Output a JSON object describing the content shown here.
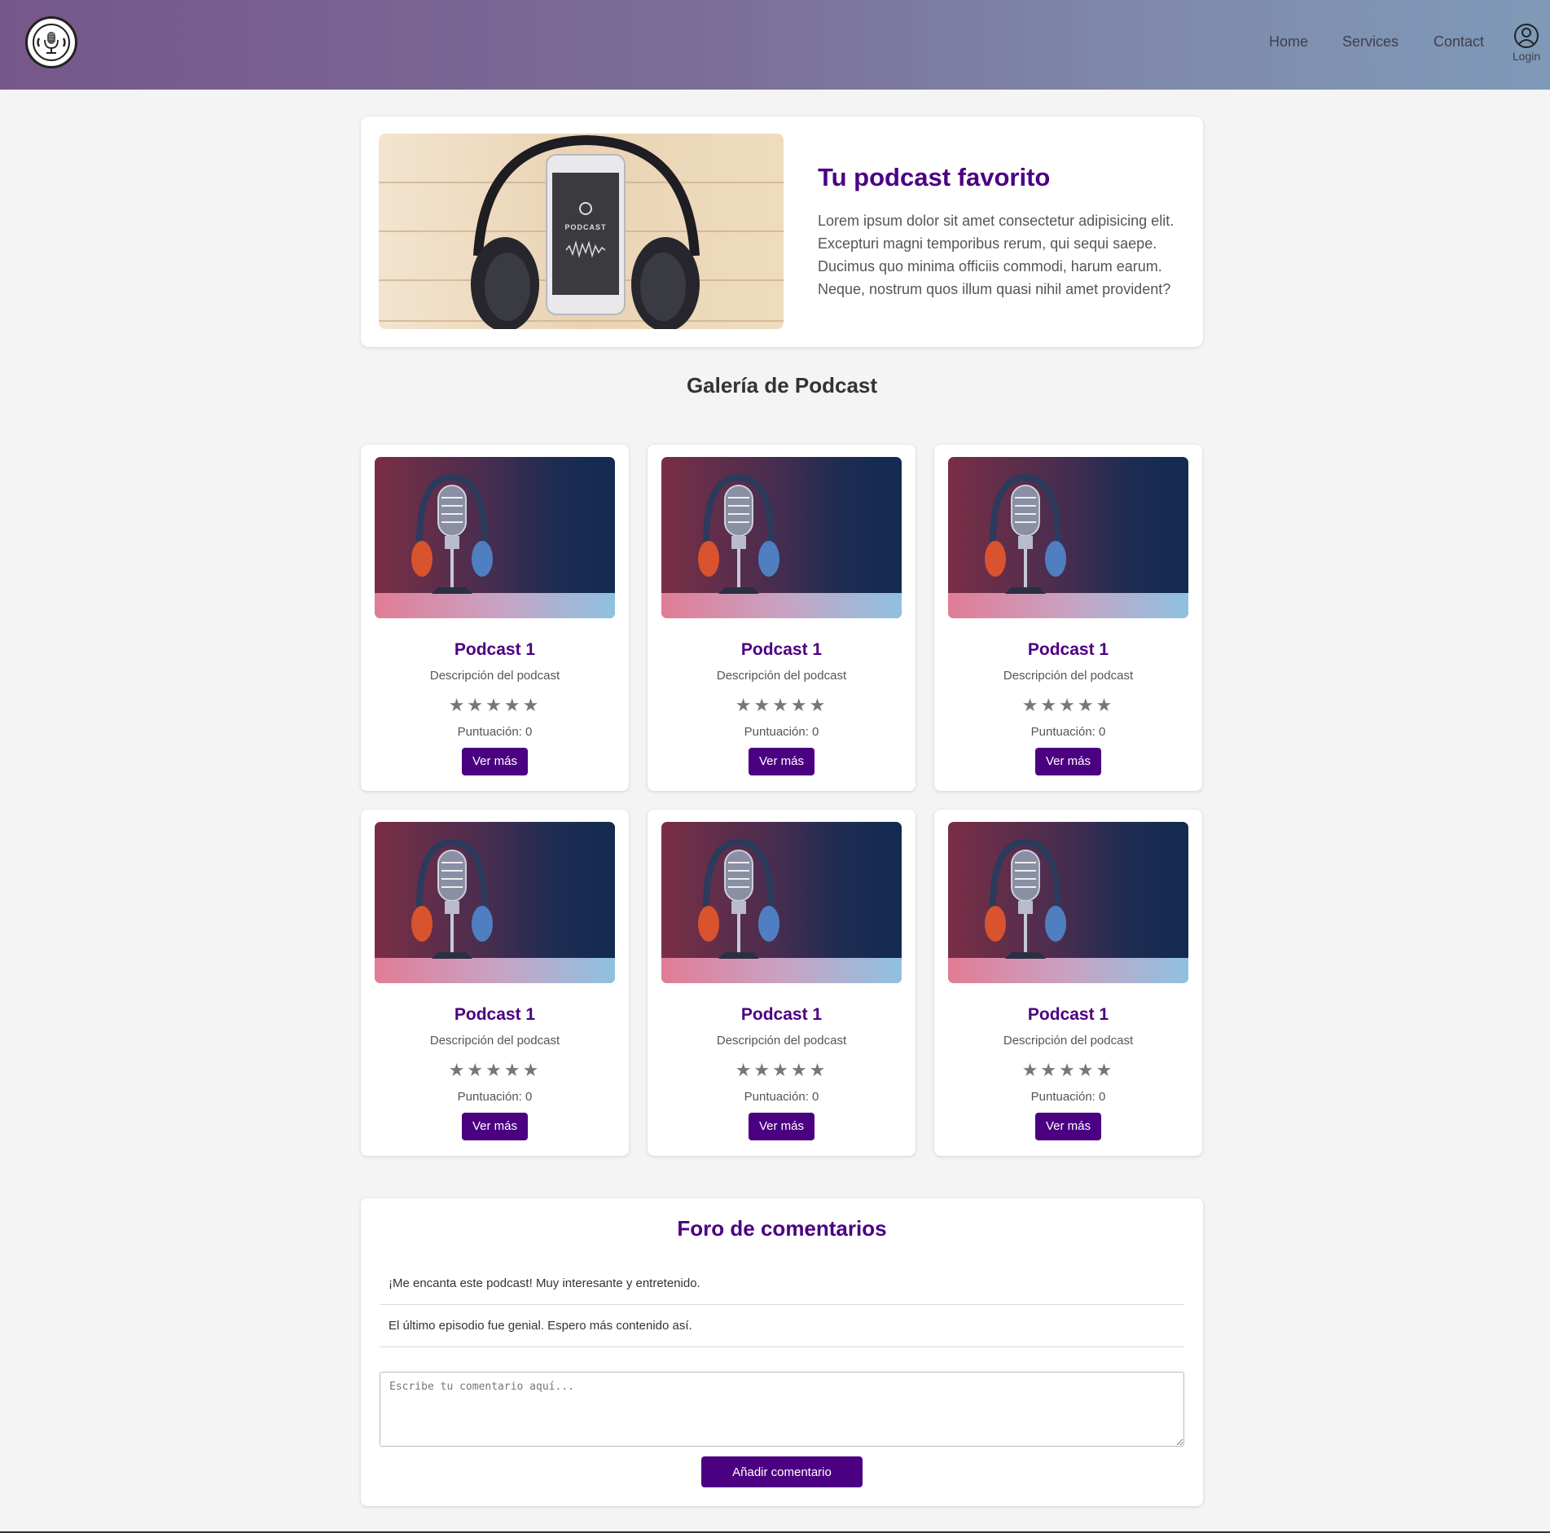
{
  "header": {
    "nav": [
      {
        "label": "Home"
      },
      {
        "label": "Services"
      },
      {
        "label": "Contact"
      }
    ],
    "login_label": "Login",
    "gradient_colors": [
      "#76578a",
      "#7f9ab8"
    ]
  },
  "hero": {
    "image_text": "PODCAST",
    "title": "Tu podcast favorito",
    "text": "Lorem ipsum dolor sit amet consectetur adipisicing elit. Excepturi magni temporibus rerum, qui sequi saepe. Ducimus quo minima officiis commodi, harum earum. Neque, nostrum quos illum quasi nihil amet provident?"
  },
  "gallery": {
    "title": "Galería de Podcast",
    "cards": [
      {
        "title": "Podcast 1",
        "description": "Descripción del podcast",
        "stars": "★★★★★",
        "rating": 0,
        "score_label": "Puntuación: 0",
        "button": "Ver más"
      },
      {
        "title": "Podcast 1",
        "description": "Descripción del podcast",
        "stars": "★★★★★",
        "rating": 0,
        "score_label": "Puntuación: 0",
        "button": "Ver más"
      },
      {
        "title": "Podcast 1",
        "description": "Descripción del podcast",
        "stars": "★★★★★",
        "rating": 0,
        "score_label": "Puntuación: 0",
        "button": "Ver más"
      },
      {
        "title": "Podcast 1",
        "description": "Descripción del podcast",
        "stars": "★★★★★",
        "rating": 0,
        "score_label": "Puntuación: 0",
        "button": "Ver más"
      },
      {
        "title": "Podcast 1",
        "description": "Descripción del podcast",
        "stars": "★★★★★",
        "rating": 0,
        "score_label": "Puntuación: 0",
        "button": "Ver más"
      },
      {
        "title": "Podcast 1",
        "description": "Descripción del podcast",
        "stars": "★★★★★",
        "rating": 0,
        "score_label": "Puntuación: 0",
        "button": "Ver más"
      }
    ]
  },
  "forum": {
    "title": "Foro de comentarios",
    "comments": [
      "¡Me encanta este podcast! Muy interesante y entretenido.",
      "El último episodio fue genial. Espero más contenido así."
    ],
    "input_placeholder": "Escribe tu comentario aquí...",
    "input_value": "",
    "submit_label": "Añadir comentario"
  },
  "colors": {
    "accent": "#4b0082",
    "page_background": "#f4f4f4",
    "card_background": "#ffffff"
  },
  "icons": {
    "logo": "microphone-logo-icon",
    "login": "user-icon",
    "rating": "star-icon"
  }
}
